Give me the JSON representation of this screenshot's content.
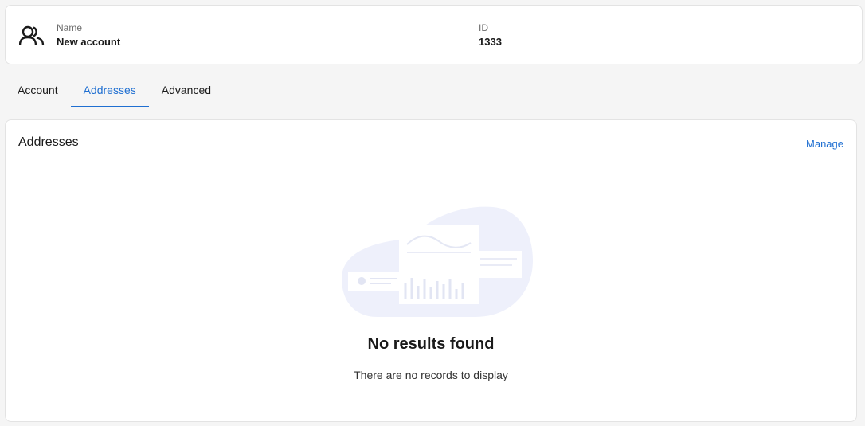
{
  "header": {
    "icon": "users-icon",
    "name_label": "Name",
    "name_value": "New account",
    "id_label": "ID",
    "id_value": "1333"
  },
  "tabs": [
    {
      "label": "Account",
      "active": false
    },
    {
      "label": "Addresses",
      "active": true
    },
    {
      "label": "Advanced",
      "active": false
    }
  ],
  "panel": {
    "title": "Addresses",
    "manage_label": "Manage",
    "empty_title": "No results found",
    "empty_subtitle": "There are no records to display",
    "illustration_icon": "empty-documents-illustration"
  },
  "colors": {
    "accent": "#1f6fd1",
    "background": "#f5f5f5",
    "illustration_tint": "#eef0fb"
  }
}
